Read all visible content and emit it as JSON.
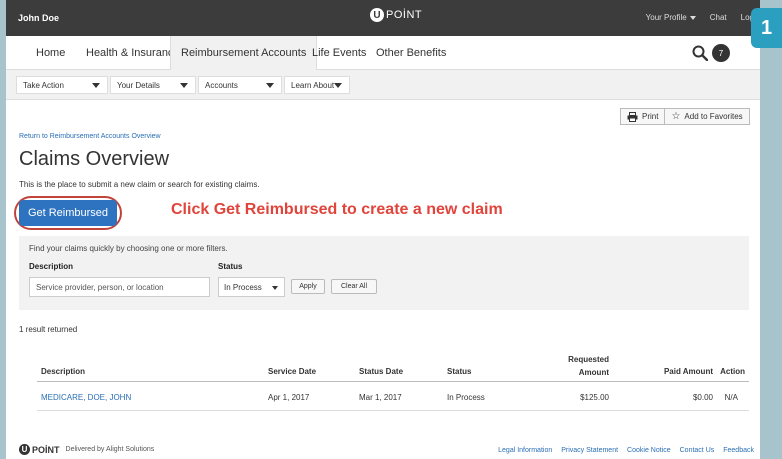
{
  "topbar": {
    "user_name": "John Doe",
    "logo_letter": "U",
    "logo_text": "POİNT",
    "links": [
      "Your Profile",
      "Chat",
      "Log"
    ]
  },
  "step_badge": "1",
  "main_nav": {
    "tabs": [
      "Home",
      "Health & Insurance",
      "Reimbursement Accounts",
      "Life Events",
      "Other Benefits"
    ],
    "active": "Reimbursement Accounts",
    "notification_count": "7"
  },
  "sub_nav": {
    "dropdowns": [
      "Take Action",
      "Your Details",
      "Accounts",
      "Learn About"
    ]
  },
  "utility": {
    "print": "Print",
    "favorites": "Add to Favorites"
  },
  "page": {
    "return_link": "Return to Reimbursement Accounts Overview",
    "title": "Claims Overview",
    "description": "This is the place to submit a new claim or search for existing claims.",
    "primary_button": "Get Reimbursed",
    "callout": "Click Get Reimbursed to create a new claim"
  },
  "filters": {
    "hint": "Find your claims quickly by choosing one or more filters.",
    "description_label": "Description",
    "description_placeholder": "Service provider, person, or location",
    "status_label": "Status",
    "status_value": "In Process",
    "apply": "Apply",
    "clear_all": "Clear All"
  },
  "results": {
    "count_text": "1 result returned",
    "headers": {
      "description": "Description",
      "service_date": "Service Date",
      "status_date": "Status Date",
      "status": "Status",
      "requested_amount_line1": "Requested",
      "requested_amount_line2": "Amount",
      "paid_amount": "Paid Amount",
      "action": "Action"
    },
    "rows": [
      {
        "description": "MEDICARE, DOE, JOHN",
        "service_date": "Apr 1, 2017",
        "status_date": "Mar 1, 2017",
        "status": "In Process",
        "requested_amount": "$125.00",
        "paid_amount": "$0.00",
        "action": "N/A"
      }
    ]
  },
  "footer": {
    "logo_letter": "U",
    "brand": "POİNT",
    "delivered_by": "Delivered by Alight Solutions",
    "links": [
      "Legal Information",
      "Privacy Statement",
      "Cookie Notice",
      "Contact Us",
      "Feedback"
    ]
  },
  "colors": {
    "topbar": "#3c3c3c",
    "primary_button": "#2e73c0",
    "callout": "#e0443b",
    "badge": "#2b9fc0",
    "link": "#2a6fb5"
  }
}
